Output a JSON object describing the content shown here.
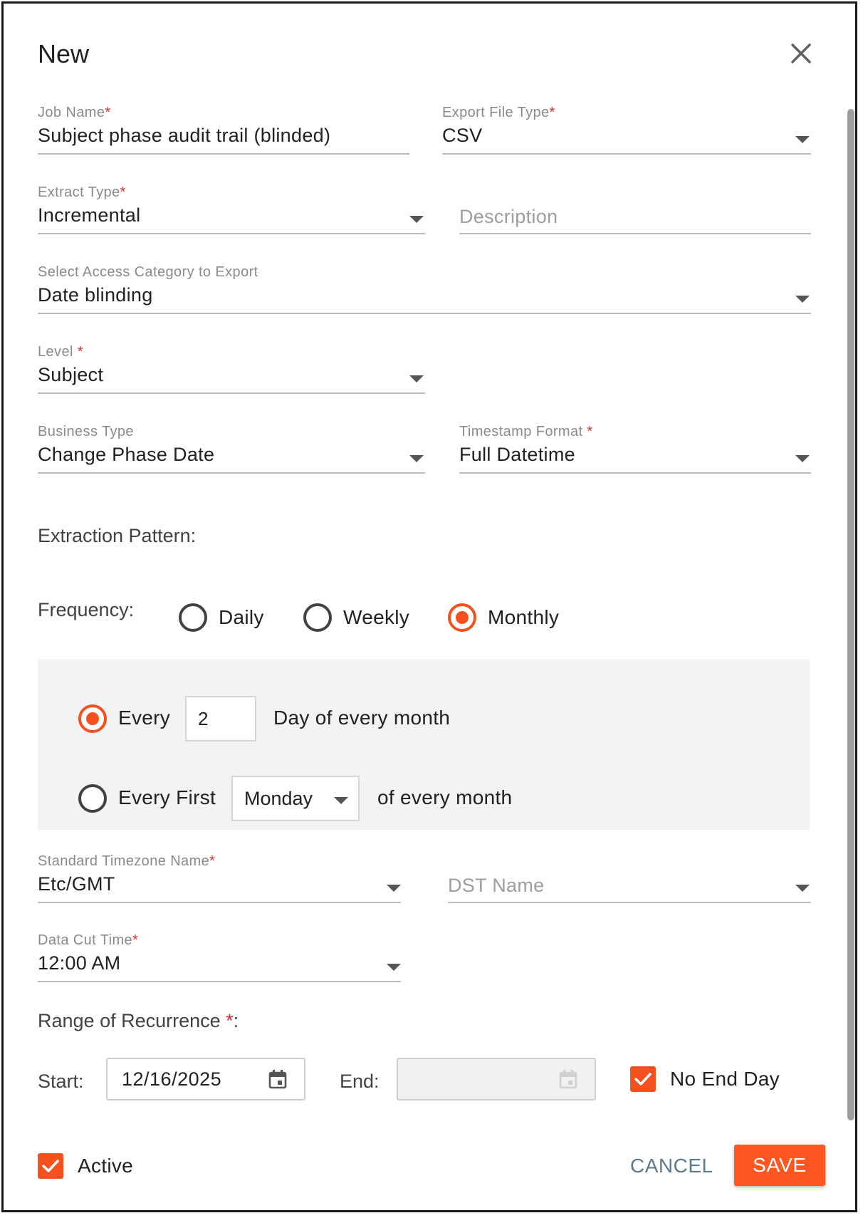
{
  "dialog": {
    "title": "New"
  },
  "fields": {
    "job_name": {
      "label": "Job Name",
      "required": "*",
      "value": "Subject phase audit trail (blinded)"
    },
    "export_file_type": {
      "label": "Export File Type",
      "required": "*",
      "value": "CSV"
    },
    "extract_type": {
      "label": "Extract Type",
      "required": "*",
      "value": "Incremental"
    },
    "description": {
      "placeholder": "Description"
    },
    "access_category": {
      "label": "Select Access Category to Export",
      "value": "Date blinding"
    },
    "level": {
      "label": "Level ",
      "required": "*",
      "value": "Subject"
    },
    "business_type": {
      "label": "Business Type",
      "value": "Change Phase Date"
    },
    "timestamp_format": {
      "label": "Timestamp Format ",
      "required": "*",
      "value": "Full Datetime"
    },
    "timezone": {
      "label": "Standard Timezone Name",
      "required": "*",
      "value": "Etc/GMT"
    },
    "dst_name": {
      "placeholder": "DST Name"
    },
    "data_cut_time": {
      "label": "Data Cut Time",
      "required": "*",
      "value": "12:00 AM"
    }
  },
  "extraction": {
    "title": "Extraction Pattern:",
    "frequency_label": "Frequency:",
    "options": [
      "Daily",
      "Weekly",
      "Monthly"
    ],
    "selected": "Monthly",
    "monthly": {
      "every_label": "Every",
      "every_value": "2",
      "every_suffix": "Day of every month",
      "every_first_label": "Every First",
      "weekday_value": "Monday",
      "every_first_suffix": "of every month"
    }
  },
  "recurrence": {
    "title": "Range of Recurrence ",
    "required": "*",
    "title_suffix": ":",
    "start_label": "Start:",
    "start_value": "12/16/2025",
    "end_label": "End:",
    "end_value": "",
    "no_end_day_label": "No End Day",
    "no_end_day_checked": true
  },
  "footer": {
    "active_label": "Active",
    "active_checked": true,
    "cancel_label": "CANCEL",
    "save_label": "SAVE"
  },
  "colors": {
    "accent": "#ff5722",
    "required": "#d32f2f",
    "cancel": "#5b7a8c"
  },
  "icons": {
    "close": "close-icon",
    "dropdown": "chevron-down-icon",
    "calendar": "calendar-icon",
    "check": "check-icon"
  }
}
